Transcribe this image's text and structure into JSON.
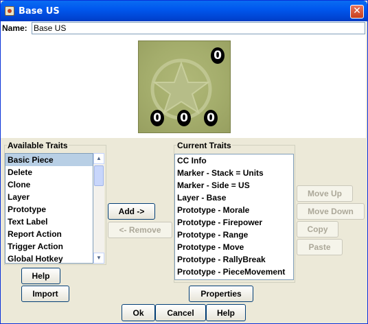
{
  "window": {
    "title": "Base US",
    "close_glyph": "✕"
  },
  "name_field": {
    "label": "Name:",
    "value": "Base US"
  },
  "piece_image": {
    "top_right_value": "0",
    "bottom_values": [
      "0",
      "0",
      "0"
    ],
    "background_color": "#a4ad6c"
  },
  "available_traits": {
    "title": "Available Traits",
    "items": [
      "Basic Piece",
      "Delete",
      "Clone",
      "Layer",
      "Prototype",
      "Text Label",
      "Report Action",
      "Trigger Action",
      "Global Hotkey"
    ],
    "selected": "Basic Piece"
  },
  "current_traits": {
    "title": "Current Traits",
    "items": [
      "CC Info",
      "Marker - Stack = Units",
      "Marker - Side = US",
      "Layer - Base",
      "Prototype - Morale",
      "Prototype - Firepower",
      "Prototype - Range",
      "Prototype - Move",
      "Prototype - RallyBreak",
      "Prototype - PieceMovement"
    ]
  },
  "buttons": {
    "add": "Add ->",
    "remove": "<- Remove",
    "move_up": "Move Up",
    "move_down": "Move Down",
    "copy": "Copy",
    "paste": "Paste",
    "help_left": "Help",
    "import": "Import",
    "properties": "Properties",
    "ok": "Ok",
    "cancel": "Cancel",
    "help_bottom": "Help"
  }
}
